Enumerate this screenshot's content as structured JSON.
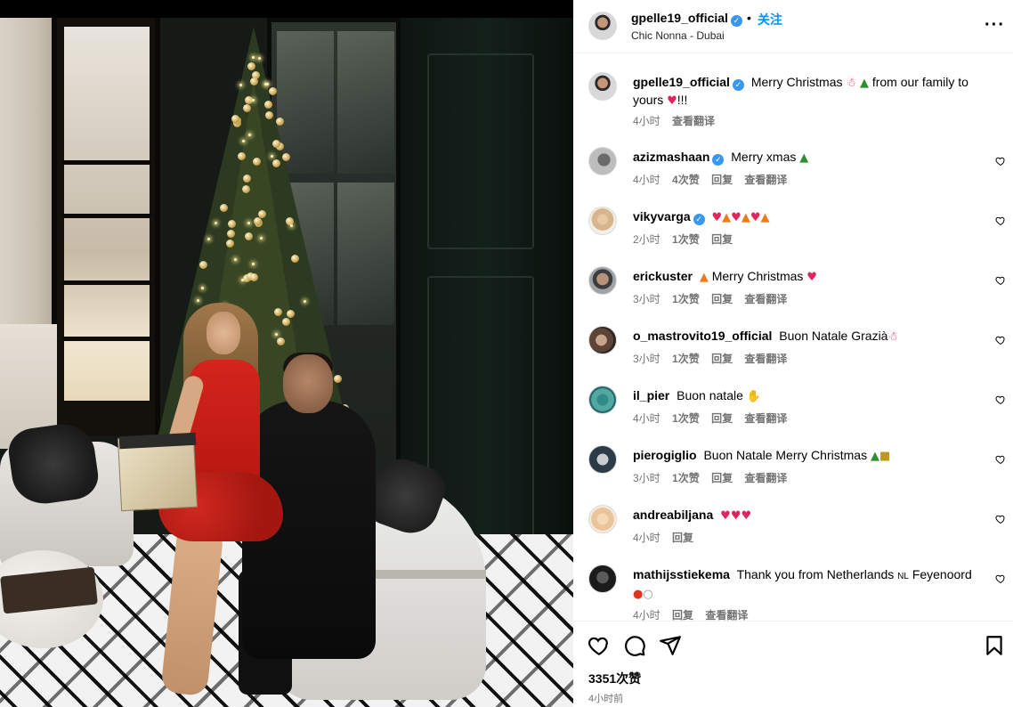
{
  "post": {
    "username": "gpelle19_official",
    "follow_label": "关注",
    "separator": "•",
    "location": "Chic Nonna - Dubai",
    "more_icon": "more-horizontal-icon",
    "more_label": "···"
  },
  "caption": {
    "username": "gpelle19_official",
    "text_before": "Merry Christmas",
    "text_middle": "from our family to yours",
    "text_after": "!!!",
    "emojis": [
      "santa",
      "christmas-tree",
      "red-heart"
    ],
    "time": "4小时",
    "translate": "查看翻译"
  },
  "comments": [
    {
      "username": "azizmashaan",
      "verified": true,
      "text": "Merry xmas",
      "emojis": [
        "christmas-tree"
      ],
      "time": "4小时",
      "likes": "4次赞",
      "reply": "回复",
      "translate": "查看翻译"
    },
    {
      "username": "vikyvarga",
      "verified": true,
      "text": "",
      "emojis": [
        "red-heart",
        "fire",
        "red-heart",
        "fire",
        "red-heart",
        "fire"
      ],
      "time": "2小时",
      "likes": "1次赞",
      "reply": "回复",
      "translate": ""
    },
    {
      "username": "erickuster",
      "verified": false,
      "text": "Merry Christmas",
      "emojis": [
        "fire",
        "red-heart"
      ],
      "time": "3小时",
      "likes": "1次赞",
      "reply": "回复",
      "translate": "查看翻译"
    },
    {
      "username": "o_mastrovito19_official",
      "verified": false,
      "text": "Buon Natale Grazià",
      "emojis": [
        "santa"
      ],
      "time": "3小时",
      "likes": "1次赞",
      "reply": "回复",
      "translate": "查看翻译"
    },
    {
      "username": "il_pier",
      "verified": false,
      "text": "Buon natale",
      "emojis": [
        "folded-hands"
      ],
      "time": "4小时",
      "likes": "1次赞",
      "reply": "回复",
      "translate": "查看翻译"
    },
    {
      "username": "pierogiglio",
      "verified": false,
      "text": "Buon Natale Merry Christmas",
      "emojis": [
        "christmas-tree",
        "gift"
      ],
      "time": "3小时",
      "likes": "1次赞",
      "reply": "回复",
      "translate": "查看翻译"
    },
    {
      "username": "andreabiljana",
      "verified": false,
      "text": "",
      "emojis": [
        "red-heart",
        "red-heart",
        "red-heart"
      ],
      "time": "4小时",
      "likes": "",
      "reply": "回复",
      "translate": ""
    },
    {
      "username": "mathijsstiekema",
      "verified": false,
      "text": "Thank you from Netherlands",
      "flag": "NL",
      "text2": "Feyenoord",
      "emojis": [
        "red-circle",
        "white-circle"
      ],
      "time": "4小时",
      "likes": "",
      "reply": "回复",
      "translate": "查看翻译"
    }
  ],
  "footer": {
    "likes": "3351次赞",
    "time": "4小时前",
    "icons": [
      "heart-icon",
      "comment-icon",
      "share-icon",
      "bookmark-icon"
    ]
  },
  "colors": {
    "accent": "#0095f6",
    "verified": "#3897f0",
    "meta": "#737373",
    "border": "#efefef"
  }
}
